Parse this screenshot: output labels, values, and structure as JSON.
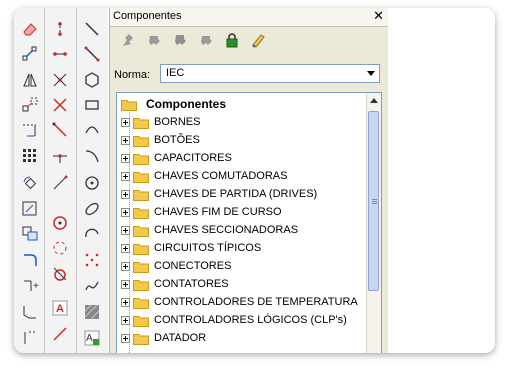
{
  "panel": {
    "title": "Componentes",
    "close_label": "✕",
    "norma_label": "Norma:",
    "norma_value": "IEC"
  },
  "tree": {
    "root_label": "Componentes",
    "items": [
      {
        "label": "BORNES"
      },
      {
        "label": "BOTÕES"
      },
      {
        "label": "CAPACITORES"
      },
      {
        "label": "CHAVES COMUTADORAS"
      },
      {
        "label": "CHAVES DE PARTIDA (DRIVES)"
      },
      {
        "label": "CHAVES FIM DE CURSO"
      },
      {
        "label": "CHAVES SECCIONADORAS"
      },
      {
        "label": "CIRCUITOS TÍPICOS"
      },
      {
        "label": "CONECTORES"
      },
      {
        "label": "CONTATORES"
      },
      {
        "label": "CONTROLADORES DE TEMPERATURA"
      },
      {
        "label": "CONTROLADORES LÓGICOS (CLP's)"
      },
      {
        "label": "DATADOR"
      }
    ]
  },
  "colors": {
    "folder": "#f2c94c",
    "folder_edge": "#c99a1b",
    "tool_red": "#cc2a2a",
    "tool_blue": "#1d55c4"
  }
}
